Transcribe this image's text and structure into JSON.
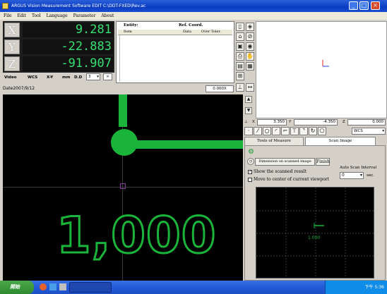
{
  "window": {
    "title": "ARGUS Vision Measurement Software   EDIT C:\\DDT-FXED\\Rev.ac"
  },
  "menu": [
    "File",
    "Edit",
    "Tool",
    "Language",
    "Parameter",
    "About"
  ],
  "dro": {
    "x_label": "X",
    "x_value": "9.281",
    "y_label": "Y",
    "y_value": "-22.883",
    "z_label": "Z",
    "z_value": "-91.907"
  },
  "video_bar": {
    "video": "Video",
    "wcs": "WCS",
    "xy": "X-Y",
    "unit": "mm",
    "dd": "D.D",
    "dd_value": "3"
  },
  "table": {
    "entity": "Entity:",
    "ref_coord": "Ref. Coord.",
    "columns": [
      "Item",
      "Data",
      "Over Toler."
    ]
  },
  "date_bar": {
    "date": "Date2007/9/12",
    "zoom": "0.000X"
  },
  "camera": {
    "big_number": "1,000"
  },
  "coords": {
    "x_label": "X",
    "x_value": "3.350",
    "y_label": "Y",
    "y_value": "-4.350",
    "z_label": "Z",
    "z_value": "0.000",
    "wcs": "WCS"
  },
  "tabs": [
    "Tools of Measure",
    "Scan Image"
  ],
  "scan": {
    "dimension_label": "Dimension on scanned image",
    "finish": "Finish",
    "show_result": "Show the scanned result",
    "move_center": "Move to center of current viewport",
    "auto_scan_label": "Auto Scan Interval",
    "interval_value": "0",
    "sec": "sec.",
    "grid_label": "1.000"
  },
  "taskbar": {
    "start": "開始",
    "clock": "下午 5:36"
  },
  "colors": {
    "overlay_green": "#1ab43a",
    "dro_green": "#38e070"
  }
}
